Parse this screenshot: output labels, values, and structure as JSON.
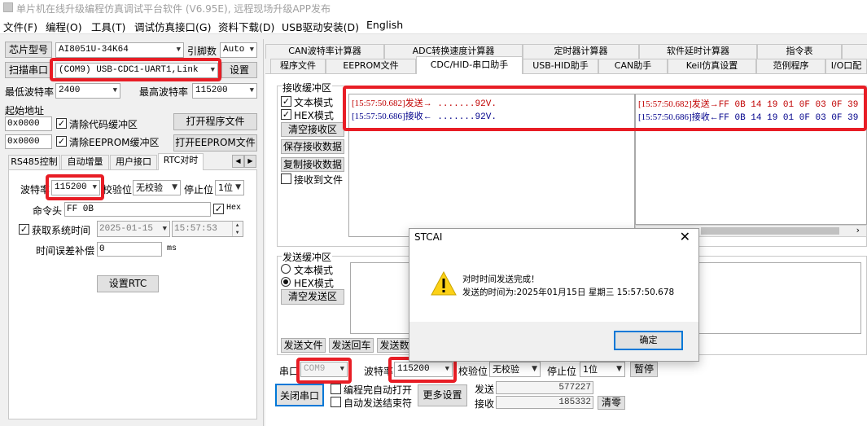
{
  "window": {
    "title": "单片机在线升级编程仿真调试平台软件 (V6.95E), 远程现场升级APP发布"
  },
  "menu": [
    "文件(F)",
    "编程(O)",
    "工具(T)",
    "调试仿真接口(G)",
    "资料下载(D)",
    "USB驱动安装(D)",
    "English"
  ],
  "left": {
    "chip_model_label": "芯片型号",
    "chip_model_value": "AI8051U-34K64",
    "pin_count_label": "引脚数",
    "pin_count_value": "Auto",
    "scan_port_button": "扫描串口",
    "port_value": "(COM9) USB-CDC1-UART1,Link",
    "settings_button": "设置",
    "min_baud_label": "最低波特率",
    "min_baud_value": "2400",
    "max_baud_label": "最高波特率",
    "max_baud_value": "115200",
    "start_addr_label": "起始地址",
    "addr1_value": "0x0000",
    "clear_code_buffer_label": "清除代码缓冲区",
    "open_program_button": "打开程序文件",
    "addr2_value": "0x0000",
    "clear_eeprom_buffer_label": "清除EEPROM缓冲区",
    "open_eeprom_button": "打开EEPROM文件",
    "tabs": [
      "RS485控制",
      "自动增量",
      "用户接口",
      "RTC对时"
    ],
    "rtc": {
      "baud_label": "波特率",
      "baud_value": "115200",
      "parity_label": "校验位",
      "parity_value": "无校验",
      "stop_label": "停止位",
      "stop_value": "1位",
      "cmd_header_label": "命令头",
      "cmd_header_value": "FF 0B",
      "hex_label": "Hex",
      "get_time_label": "获取系统时间",
      "date_value": "2025-01-15",
      "time_value": "15:57:53",
      "error_comp_label": "时间误差补偿",
      "error_comp_value": "0",
      "unit_ms": "ms",
      "set_rtc_button": "设置RTC"
    }
  },
  "right": {
    "tabs_row1": [
      "CAN波特率计算器",
      "ADC转换速度计算器",
      "定时器计算器",
      "软件延时计算器",
      "指令表",
      ""
    ],
    "tabs_row2": [
      "程序文件",
      "EEPROM文件",
      "CDC/HID-串口助手",
      "USB-HID助手",
      "CAN助手",
      "Keil仿真设置",
      "范例程序",
      "I/O口配"
    ],
    "recv": {
      "group_label": "接收缓冲区",
      "text_mode": "文本模式",
      "hex_mode": "HEX模式",
      "clear_button": "清空接收区",
      "save_button": "保存接收数据",
      "copy_button": "复制接收数据",
      "to_file_label": "接收到文件",
      "text_log": [
        {
          "ts": "[15:57:50.682]",
          "dir": "发送→",
          "data": " .......92V.",
          "color": "#c00000"
        },
        {
          "ts": "[15:57:50.686]",
          "dir": "接收←",
          "data": " .......92V.",
          "color": "#00008b"
        }
      ],
      "hex_log": [
        {
          "ts": "[15:57:50.682]",
          "dir": "发送→",
          "data": "FF 0B 14 19 01 0F 03 0F 39",
          "color": "#c00000"
        },
        {
          "ts": "[15:57:50.686]",
          "dir": "接收←",
          "data": "FF 0B 14 19 01 0F 03 0F 39",
          "color": "#00008b"
        }
      ]
    },
    "send": {
      "group_label": "发送缓冲区",
      "text_mode": "文本模式",
      "hex_mode": "HEX模式",
      "clear_button": "清空发送区",
      "send_file_button": "发送文件",
      "send_enter_button": "发送回车",
      "send_data_button": "发送数据"
    },
    "bottom": {
      "port_label": "串口",
      "port_value": "COM9",
      "baud_label": "波特率",
      "baud_value": "115200",
      "parity_label": "校验位",
      "parity_value": "无校验",
      "stop_label": "停止位",
      "stop_value": "1位",
      "pause_button": "暂停",
      "close_port_button": "关闭串口",
      "auto_open_label": "编程完自动打开",
      "auto_send_label": "自动发送结束符",
      "more_settings_button": "更多设置",
      "sent_label": "发送",
      "sent_value": "577227",
      "recv_label": "接收",
      "recv_value": "185332",
      "clear_count_button": "清零"
    }
  },
  "dialog": {
    "title": "STCAI",
    "line1": "对时时间发送完成！",
    "line2": "发送的时间为:2025年01月15日 星期三 15:57:50.678",
    "ok_button": "确定"
  },
  "colors": {
    "highlight": "#e81d25",
    "send_text": "#c00000",
    "recv_text": "#00008b"
  }
}
